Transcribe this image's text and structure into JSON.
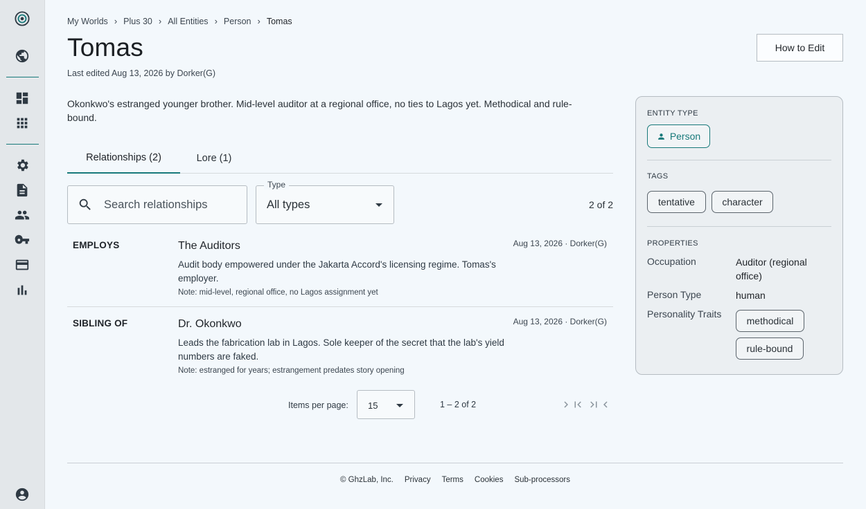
{
  "sidebar": {
    "items": [
      {
        "icon": "target-logo-icon"
      },
      {
        "icon": "globe-icon"
      },
      {
        "icon": "dashboard-icon"
      },
      {
        "icon": "grid-icon"
      },
      {
        "icon": "gear-icon"
      },
      {
        "icon": "document-icon"
      },
      {
        "icon": "people-icon"
      },
      {
        "icon": "key-icon"
      },
      {
        "icon": "credit-card-icon"
      },
      {
        "icon": "bar-chart-icon"
      },
      {
        "icon": "account-circle-icon"
      }
    ]
  },
  "breadcrumb": [
    "My Worlds",
    "Plus 30",
    "All Entities",
    "Person",
    "Tomas"
  ],
  "page": {
    "title": "Tomas",
    "last_edited": "Last edited Aug 13, 2026 by Dorker(G)",
    "how_to_edit": "How to Edit",
    "description": "Okonkwo's estranged younger brother. Mid-level auditor at a regional office, no ties to Lagos yet. Methodical and rule-bound."
  },
  "tabs": [
    {
      "label": "Relationships (2)",
      "active": true
    },
    {
      "label": "Lore (1)",
      "active": false
    }
  ],
  "filters": {
    "search_placeholder": "Search relationships",
    "type_label": "Type",
    "type_value": "All types",
    "count": "2 of 2"
  },
  "relationships": [
    {
      "type": "EMPLOYS",
      "name": "The Auditors",
      "meta": "Aug 13, 2026 · Dorker(G)",
      "description": "Audit body empowered under the Jakarta Accord's licensing regime. Tomas's employer.",
      "note": "Note: mid-level, regional office, no Lagos assignment yet"
    },
    {
      "type": "SIBLING OF",
      "name": "Dr. Okonkwo",
      "meta": "Aug 13, 2026 · Dorker(G)",
      "description": "Leads the fabrication lab in Lagos. Sole keeper of the secret that the lab's yield numbers are faked.",
      "note": "Note: estranged for years; estrangement predates story opening"
    }
  ],
  "pagination": {
    "items_per_page_label": "Items per page:",
    "items_per_page": "15",
    "range": "1 – 2 of 2"
  },
  "panel": {
    "entity_type_heading": "ENTITY TYPE",
    "entity_type": "Person",
    "tags_heading": "TAGS",
    "tags": [
      "tentative",
      "character"
    ],
    "properties_heading": "PROPERTIES",
    "properties": {
      "occupation_label": "Occupation",
      "occupation_value": "Auditor (regional office)",
      "person_type_label": "Person Type",
      "person_type_value": "human",
      "traits_label": "Personality Traits",
      "traits": [
        "methodical",
        "rule-bound"
      ]
    }
  },
  "footer": {
    "copyright": "© GhzLab, Inc.",
    "links": [
      "Privacy",
      "Terms",
      "Cookies",
      "Sub-processors"
    ]
  },
  "colors": {
    "accent": "#17797a",
    "background": "#f3f8fc",
    "sidebar": "#e3e7ea"
  }
}
